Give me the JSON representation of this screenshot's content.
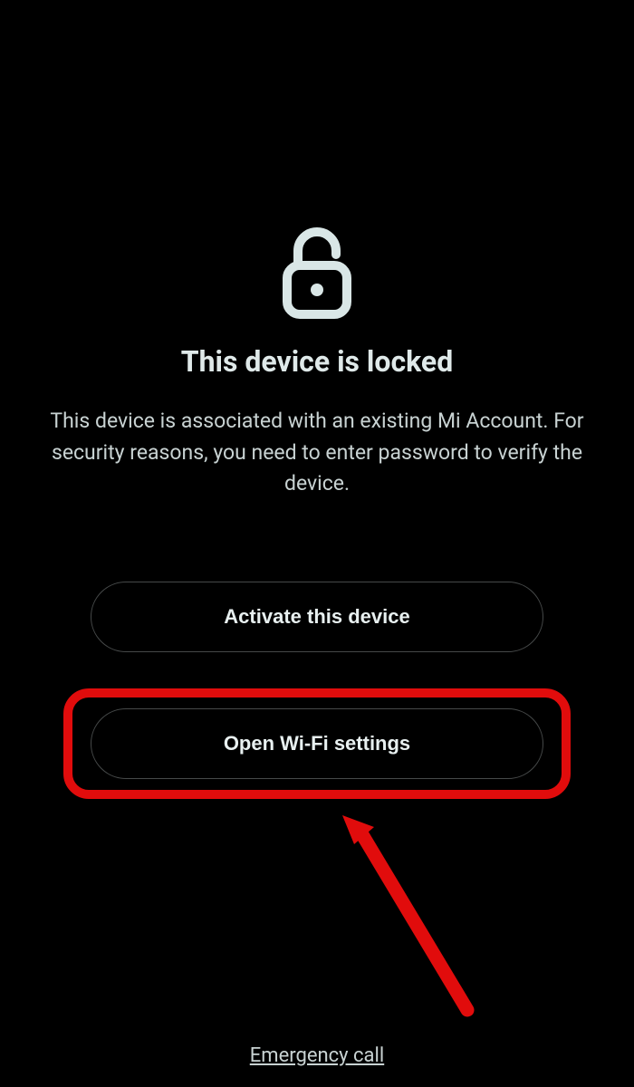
{
  "lock_screen": {
    "title": "This device is locked",
    "description": "This device is associated with an existing Mi Account. For security reasons, you need to enter password to verify the device.",
    "buttons": {
      "activate": "Activate this device",
      "wifi": "Open Wi-Fi settings"
    },
    "emergency_link": "Emergency call"
  }
}
